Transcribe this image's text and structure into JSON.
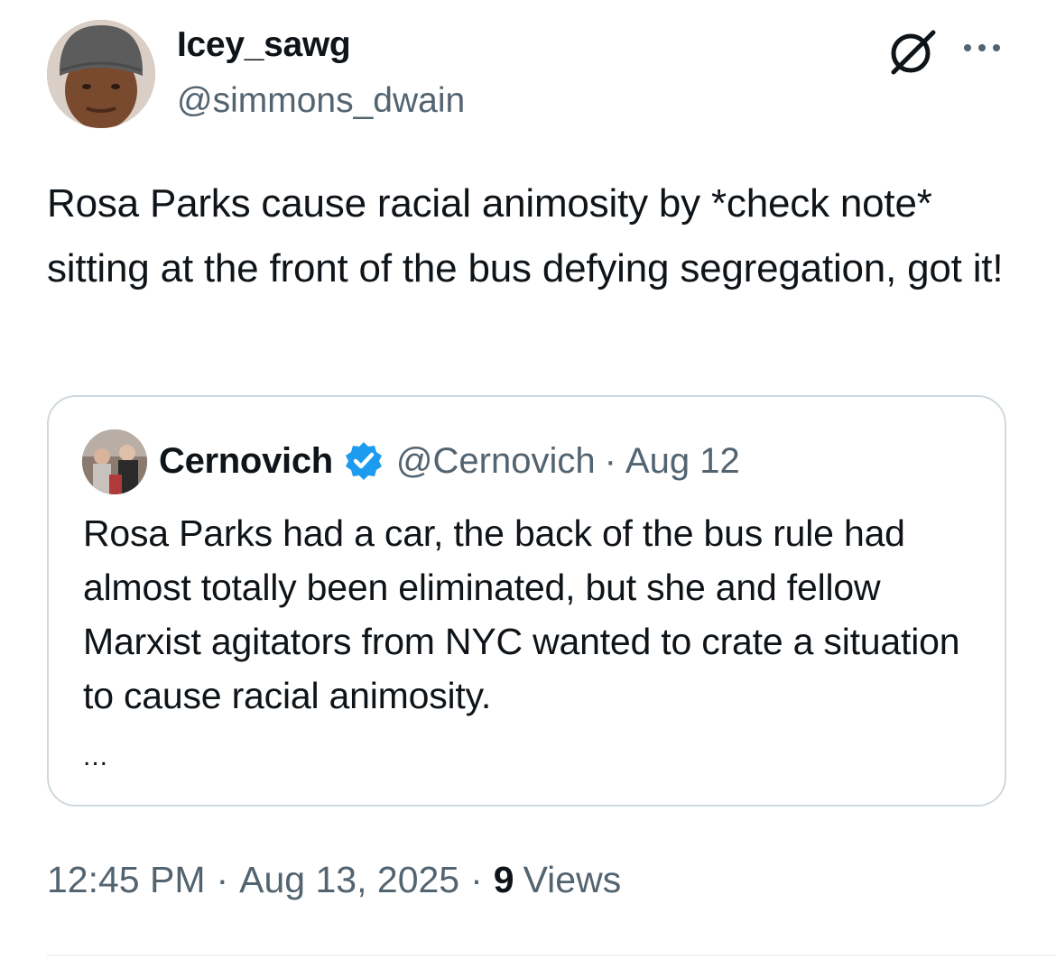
{
  "author": {
    "display_name": "Icey_sawg",
    "handle": "@simmons_dwain"
  },
  "icons": {
    "grok": "grok-icon",
    "more": "more-icon",
    "verified": "verified-badge-icon"
  },
  "tweet": {
    "text": "Rosa Parks cause racial animosity by *check note* sitting at the front of the bus defying segregation, got it!"
  },
  "quoted": {
    "display_name": "Cernovich",
    "handle": "@Cernovich",
    "separator": "·",
    "date": "Aug 12",
    "text": "Rosa Parks had a car, the back of the bus rule had almost totally been eliminated, but she and fellow Marxist agitators from NYC wanted to crate a situation to cause racial animosity.",
    "truncation": "..."
  },
  "meta": {
    "time": "12:45 PM",
    "separator": "·",
    "date": "Aug 13, 2025",
    "views_count": "9",
    "views_label": "Views"
  },
  "colors": {
    "text_primary": "#0f1419",
    "text_secondary": "#536471",
    "verified_blue": "#1d9bf0",
    "border": "#cfd9de"
  }
}
